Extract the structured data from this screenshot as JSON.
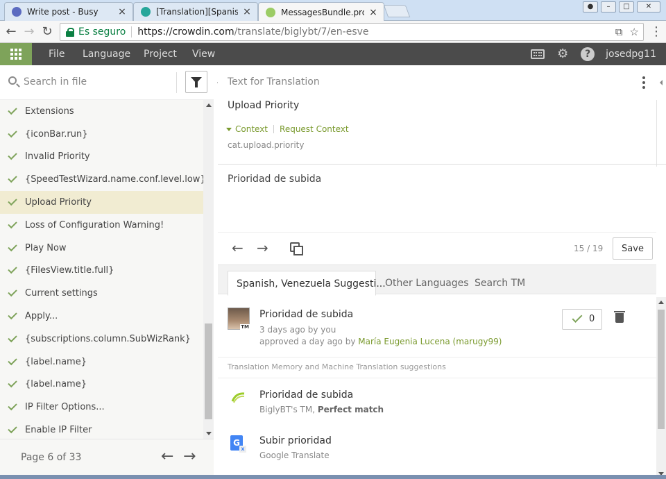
{
  "browser": {
    "tabs": [
      {
        "title": "Write post - Busy",
        "favicon_color": "#5c6bc0"
      },
      {
        "title": "[Translation][Spanish] Big",
        "favicon_color": "#26a69a"
      },
      {
        "title": "MessagesBundle.propert",
        "favicon_color": "#9ccc65"
      }
    ],
    "close_glyph": "×",
    "secure_label": "Es seguro",
    "url_host": "https://crowdin.com",
    "url_path": "/translate/biglybt/7/en-esve"
  },
  "appbar": {
    "menu": [
      "File",
      "Language",
      "Project",
      "View"
    ],
    "username": "josedpg11",
    "help_glyph": "?",
    "accent_color": "#7ea35a"
  },
  "sidebar": {
    "search_placeholder": "Search in file",
    "strings": [
      "Extensions",
      "{iconBar.run}",
      "Invalid Priority",
      "{SpeedTestWizard.name.conf.level.low}",
      "Upload Priority",
      "Loss of Configuration Warning!",
      "Play Now",
      "{FilesView.title.full}",
      "Current settings",
      "Apply...",
      "{subscriptions.column.SubWizRank}",
      "{label.name}",
      "{label.name}",
      "IP Filter Options...",
      "Enable IP Filter"
    ],
    "selected_index": 4,
    "page_label": "Page 6 of 33"
  },
  "editor": {
    "header": "Text for Translation",
    "source": "Upload Priority",
    "context_link": "Context",
    "request_context_link": "Request Context",
    "context_key": "cat.upload.priority",
    "translation": "Prioridad de subida",
    "counter": "15 / 19",
    "save_label": "Save"
  },
  "suggestions": {
    "tabs": [
      "Spanish, Venezuela Suggesti...",
      "Other Languages",
      "Search TM"
    ],
    "user_suggestion": {
      "text": "Prioridad de subida",
      "time": "3 days ago by you",
      "approved_prefix": "approved a day ago by ",
      "approved_by": "María Eugenia Lucena (marugy99)",
      "votes": "0",
      "avatar_badge": "TM"
    },
    "section_label": "Translation Memory and Machine Translation suggestions",
    "tm": [
      {
        "text": "Prioridad de subida",
        "source": "BiglyBT's TM, ",
        "match": "Perfect match"
      },
      {
        "text": "Subir prioridad",
        "source": "Google Translate",
        "match": ""
      }
    ],
    "google_glyph": "G"
  }
}
